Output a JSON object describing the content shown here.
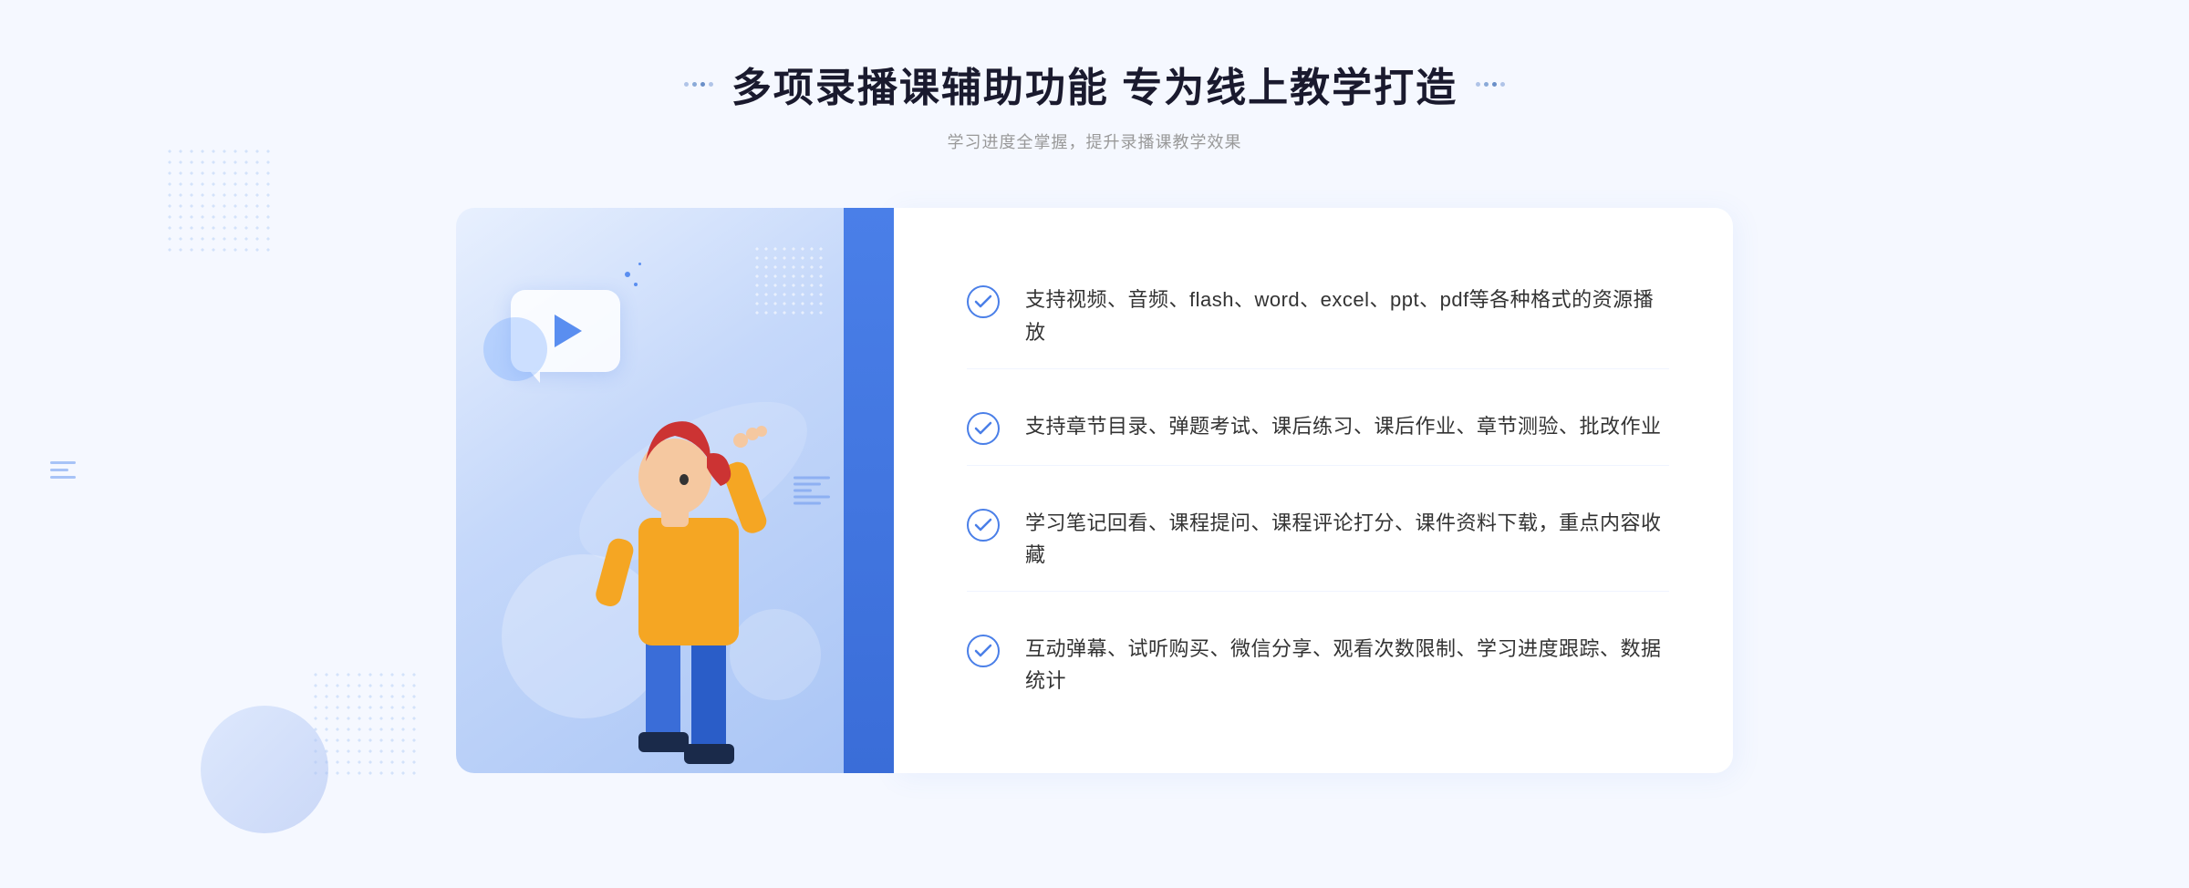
{
  "header": {
    "title": "多项录播课辅助功能 专为线上教学打造",
    "subtitle": "学习进度全掌握，提升录播课教学效果",
    "title_deco_left": "decorative-dots-left",
    "title_deco_right": "decorative-dots-right"
  },
  "features": [
    {
      "id": 1,
      "text": "支持视频、音频、flash、word、excel、ppt、pdf等各种格式的资源播放"
    },
    {
      "id": 2,
      "text": "支持章节目录、弹题考试、课后练习、课后作业、章节测验、批改作业"
    },
    {
      "id": 3,
      "text": "学习笔记回看、课程提问、课程评论打分、课件资料下载，重点内容收藏"
    },
    {
      "id": 4,
      "text": "互动弹幕、试听购买、微信分享、观看次数限制、学习进度跟踪、数据统计"
    }
  ],
  "colors": {
    "primary_blue": "#4a7fe8",
    "light_blue": "#e8f0fe",
    "text_dark": "#1a1a2e",
    "text_light": "#999999",
    "text_body": "#333333",
    "white": "#ffffff"
  },
  "icons": {
    "check": "✓",
    "play": "▶",
    "chevron_double": "»"
  }
}
